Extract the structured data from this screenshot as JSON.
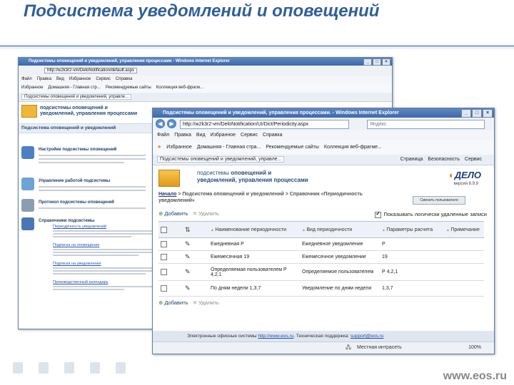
{
  "slide": {
    "title": "Подсистема уведомлений и оповещений",
    "site": "www.eos.ru"
  },
  "back_window": {
    "title": "Подсистемы оповещений и уведомлений, управления процессами - Windows Internet Explorer",
    "address": "http://w2k3r2-vm/DeloNotification/default.aspx",
    "menu": [
      "Файл",
      "Правка",
      "Вид",
      "Избранное",
      "Сервис",
      "Справка"
    ],
    "favorites": [
      "Избранное",
      "Домашняя - Главная стр...",
      "Рекомендуемые сайты",
      "Коллекция веб-фрагм..."
    ],
    "tab": "Подсистемы оповещений и уведомлений, управле...",
    "brand": [
      "подсистемы оповещений и",
      "уведомлений, управления процессами"
    ],
    "path": "Подсистема оповещений и уведомлений",
    "sections": [
      {
        "head": "Настройки подсистемы оповещений"
      },
      {
        "head": "Управление работой подсистемы"
      },
      {
        "head": "Протокол подсистемы оповещений"
      },
      {
        "head": "Справочники подсистемы"
      }
    ],
    "links": [
      "Периодичность уведомлений",
      "Подписка на оповещения",
      "Подписка на уведомления",
      "Производственный календарь"
    ]
  },
  "front_window": {
    "title": "Подсистемы оповещений и уведомлений, управления процессами. - Windows Internet Explorer",
    "address": "http://w2k3r2-vm/DeloNotification/UI/Dict/Periodicity.aspx",
    "search_placeholder": "Яндекс",
    "menu": [
      "Файл",
      "Правка",
      "Вид",
      "Избранное",
      "Сервис",
      "Справка"
    ],
    "favorites": [
      "Избранное",
      "Домашняя - Главная стра...",
      "Рекомендуемые сайты",
      "Коллекция веб-фрагме..."
    ],
    "tab": "Подсистемы оповещений и уведомлений, управле...",
    "toolbar_right": [
      "Страница",
      "Безопасность",
      "Сервис"
    ],
    "brand_light": "подсистемы",
    "brand_bold1": "оповещений и",
    "brand_bold2": "уведомлений, управления процессами",
    "product": "ДЕЛО",
    "version": "версия 8.9.9",
    "breadcrumb_home": "Начало",
    "breadcrumb_rest": " > Подсистема оповещений и уведомлений > Справочник «Периодичность уведомлений»",
    "change_button": "Сменить пользователя",
    "add_label": "Добавить",
    "delete_label": "Удалить",
    "show_deleted": "Показывать логически удаленные записи",
    "columns": [
      "Наименование периодичности",
      "Вид периодичности",
      "Параметры расчета",
      "Примечание"
    ],
    "rows": [
      {
        "name": "Ежедневная Р",
        "kind": "Ежедневное уведомление",
        "param": "Р",
        "note": ""
      },
      {
        "name": "Ежемесячная 19",
        "kind": "Ежемесячное уведомление",
        "param": "19",
        "note": ""
      },
      {
        "name": "Определяемая пользователем Р 4,2,1",
        "kind": "Определяемое пользователем",
        "param": "Р 4,2,1",
        "note": ""
      },
      {
        "name": "По дням недели 1,3,7",
        "kind": "Уведомление по дням недели",
        "param": "1,3,7",
        "note": ""
      }
    ],
    "footer_text": "Электронные офисные системы",
    "footer_link1": "http://www.eos.ru",
    "footer_support": ". Техническая поддержка:",
    "footer_link2": "support@eos.ru",
    "status_zone": "Местная интрасеть",
    "zoom": "100%"
  },
  "colors": {
    "title": "#2f5f9a",
    "titlebar": "#3f68a8",
    "logo": "#f0b63a"
  }
}
